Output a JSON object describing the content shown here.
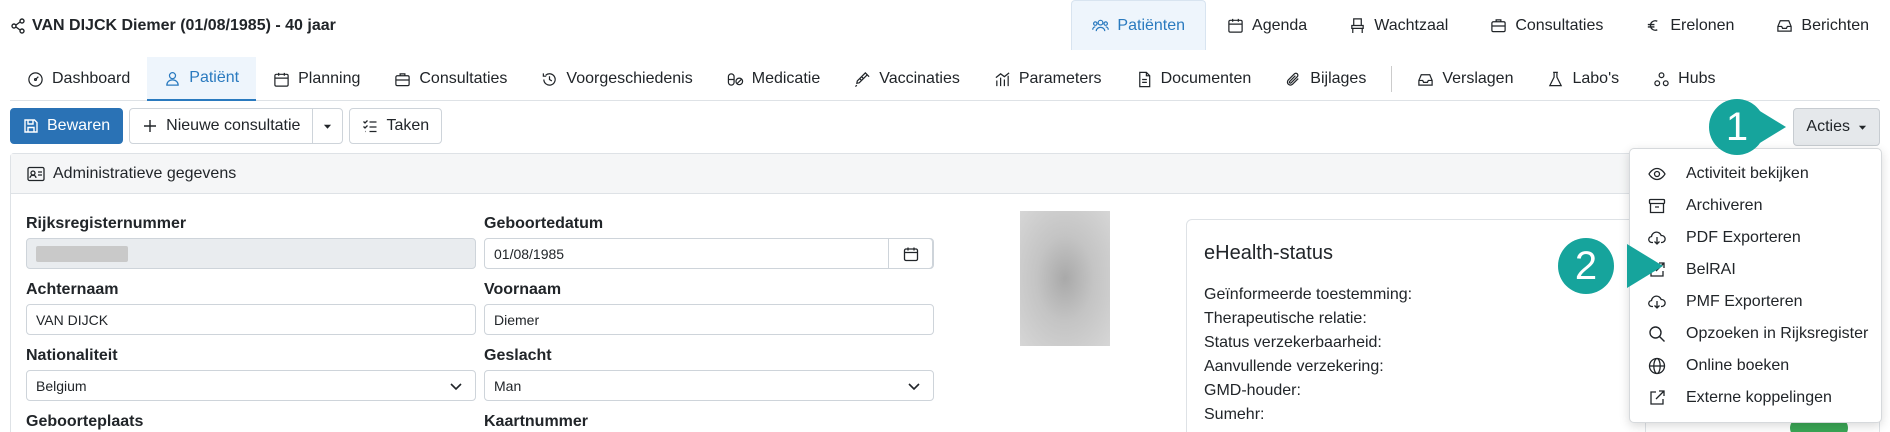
{
  "patient": {
    "title": "VAN DIJCK Diemer (01/08/1985) - 40 jaar"
  },
  "topnav": [
    {
      "label": "Patiënten",
      "icon": "users-icon",
      "active": true
    },
    {
      "label": "Agenda",
      "icon": "calendar-icon"
    },
    {
      "label": "Wachtzaal",
      "icon": "chair-icon"
    },
    {
      "label": "Consultaties",
      "icon": "briefcase-icon"
    },
    {
      "label": "Erelonen",
      "icon": "euro-icon"
    },
    {
      "label": "Berichten",
      "icon": "inbox-icon"
    }
  ],
  "subnav": [
    {
      "label": "Dashboard",
      "icon": "dashboard-icon"
    },
    {
      "label": "Patiënt",
      "icon": "user-icon",
      "active": true
    },
    {
      "label": "Planning",
      "icon": "calendar-icon"
    },
    {
      "label": "Consultaties",
      "icon": "briefcase-icon"
    },
    {
      "label": "Voorgeschiedenis",
      "icon": "history-icon"
    },
    {
      "label": "Medicatie",
      "icon": "pills-icon"
    },
    {
      "label": "Vaccinaties",
      "icon": "syringe-icon"
    },
    {
      "label": "Parameters",
      "icon": "chart-icon"
    },
    {
      "label": "Documenten",
      "icon": "document-icon"
    },
    {
      "label": "Bijlages",
      "icon": "paperclip-icon"
    },
    {
      "label": "Verslagen",
      "icon": "inbox-icon"
    },
    {
      "label": "Labo's",
      "icon": "flask-icon"
    },
    {
      "label": "Hubs",
      "icon": "hubs-icon"
    }
  ],
  "toolbar": {
    "save_label": "Bewaren",
    "new_consult_label": "Nieuwe consultatie",
    "tasks_label": "Taken",
    "actions_label": "Acties"
  },
  "card": {
    "header": "Administratieve gegevens"
  },
  "form": {
    "rijksregister_label": "Rijksregisternummer",
    "geboortedatum_label": "Geboortedatum",
    "geboortedatum_value": "01/08/1985",
    "achternaam_label": "Achternaam",
    "achternaam_value": "VAN DIJCK",
    "voornaam_label": "Voornaam",
    "voornaam_value": "Diemer",
    "nationaliteit_label": "Nationaliteit",
    "nationaliteit_value": "Belgium",
    "geslacht_label": "Geslacht",
    "geslacht_value": "Man",
    "geboorteplaats_label": "Geboorteplaats",
    "kaartnummer_label": "Kaartnummer"
  },
  "ehealth": {
    "title": "eHealth-status",
    "rows": [
      "Geïnformeerde toestemming:",
      "Therapeutische relatie:",
      "Status verzekerbaarheid:",
      "Aanvullende verzekering:",
      "GMD-houder:",
      "Sumehr:"
    ]
  },
  "acties_menu": [
    {
      "label": "Activiteit bekijken",
      "icon": "eye-icon"
    },
    {
      "label": "Archiveren",
      "icon": "archive-icon"
    },
    {
      "label": "PDF Exporteren",
      "icon": "download-cloud-icon"
    },
    {
      "label": "BelRAI",
      "icon": "external-link-icon"
    },
    {
      "label": "PMF Exporteren",
      "icon": "download-cloud-icon"
    },
    {
      "label": "Opzoeken in Rijksregister",
      "icon": "search-icon"
    },
    {
      "label": "Online boeken",
      "icon": "globe-icon"
    },
    {
      "label": "Externe koppelingen",
      "icon": "external-link-icon"
    }
  ],
  "annotations": {
    "badge1": "1",
    "badge2": "2"
  },
  "colors": {
    "accent": "#2a7abf",
    "primary_button": "#2a72b5",
    "badge": "#16a49c"
  }
}
